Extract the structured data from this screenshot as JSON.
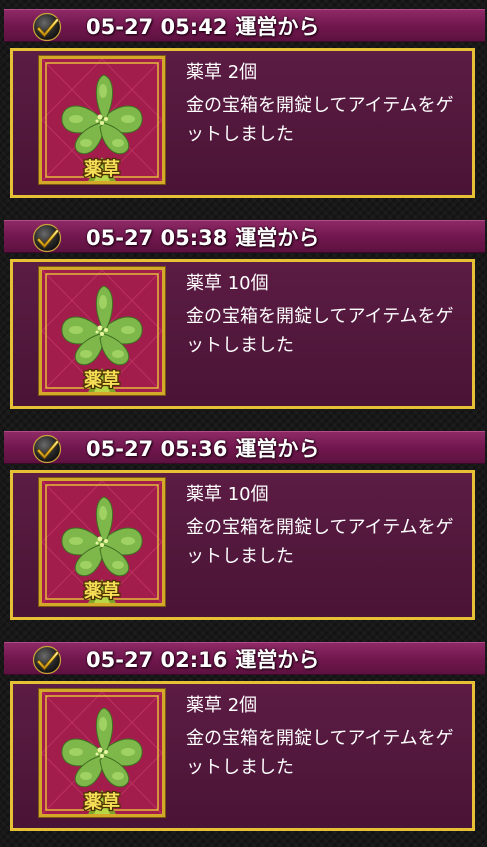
{
  "messages": [
    {
      "time": "05-27 05:42",
      "sender": "運営から",
      "item_label": "薬草",
      "item_name": "薬草 2個",
      "description": "金の宝箱を開錠してアイテムをゲットしました"
    },
    {
      "time": "05-27 05:38",
      "sender": "運営から",
      "item_label": "薬草",
      "item_name": "薬草 10個",
      "description": "金の宝箱を開錠してアイテムをゲットしました"
    },
    {
      "time": "05-27 05:36",
      "sender": "運営から",
      "item_label": "薬草",
      "item_name": "薬草 10個",
      "description": "金の宝箱を開錠してアイテムをゲットしました"
    },
    {
      "time": "05-27 02:16",
      "sender": "運営から",
      "item_label": "薬草",
      "item_name": "薬草 2個",
      "description": "金の宝箱を開錠してアイテムをゲットしました"
    }
  ],
  "icons": {
    "header_badge": "checkmark-icon",
    "item_image": "herb-icon"
  },
  "colors": {
    "header_bg": "#72174f",
    "card_border": "#e6c135",
    "card_bg": "#52183c",
    "item_bg": "#a31d4c",
    "text": "#ffffff"
  }
}
